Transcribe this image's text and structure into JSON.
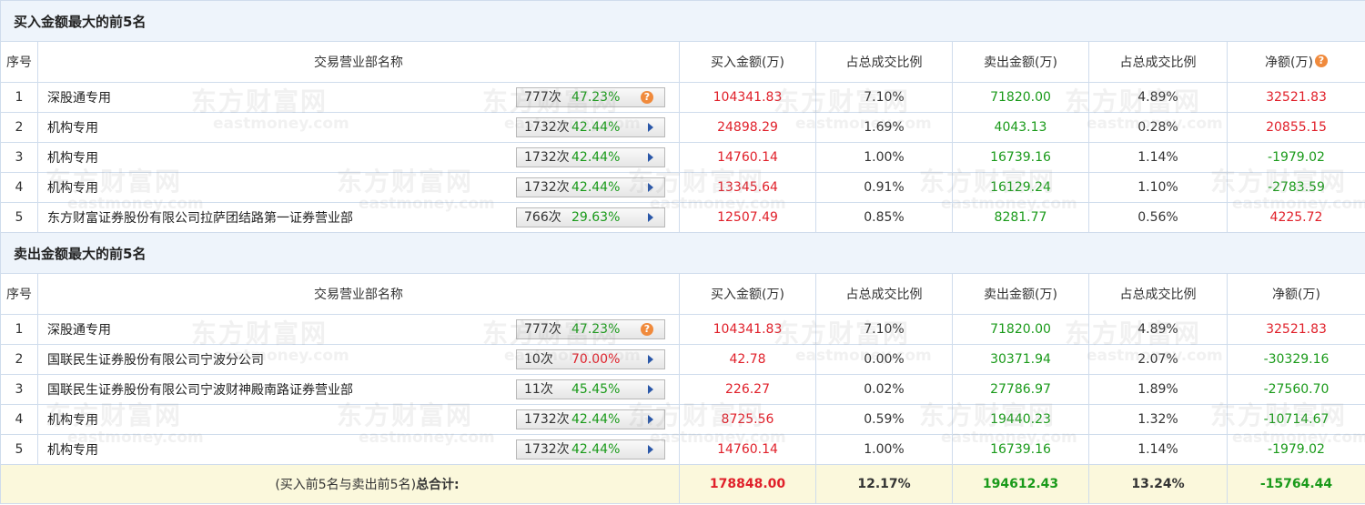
{
  "buy_section": {
    "title": "买入金额最大的前5名",
    "headers": [
      "序号",
      "交易营业部名称",
      "买入金额(万)",
      "占总成交比例",
      "卖出金额(万)",
      "占总成交比例",
      "净额(万)"
    ],
    "net_help_icon": "?",
    "rows": [
      {
        "idx": "1",
        "name": "深股通专用",
        "times": "777次",
        "pct": "47.23%",
        "buy": "104341.83",
        "buy_ratio": "7.10%",
        "sell": "71820.00",
        "sell_ratio": "4.89%",
        "net": "32521.83"
      },
      {
        "idx": "2",
        "name": "机构专用",
        "times": "1732次",
        "pct": "42.44%",
        "buy": "24898.29",
        "buy_ratio": "1.69%",
        "sell": "4043.13",
        "sell_ratio": "0.28%",
        "net": "20855.15"
      },
      {
        "idx": "3",
        "name": "机构专用",
        "times": "1732次",
        "pct": "42.44%",
        "buy": "14760.14",
        "buy_ratio": "1.00%",
        "sell": "16739.16",
        "sell_ratio": "1.14%",
        "net": "-1979.02"
      },
      {
        "idx": "4",
        "name": "机构专用",
        "times": "1732次",
        "pct": "42.44%",
        "buy": "13345.64",
        "buy_ratio": "0.91%",
        "sell": "16129.24",
        "sell_ratio": "1.10%",
        "net": "-2783.59"
      },
      {
        "idx": "5",
        "name": "东方财富证券股份有限公司拉萨团结路第一证券营业部",
        "times": "766次",
        "pct": "29.63%",
        "buy": "12507.49",
        "buy_ratio": "0.85%",
        "sell": "8281.77",
        "sell_ratio": "0.56%",
        "net": "4225.72"
      }
    ]
  },
  "sell_section": {
    "title": "卖出金额最大的前5名",
    "headers": [
      "序号",
      "交易营业部名称",
      "买入金额(万)",
      "占总成交比例",
      "卖出金额(万)",
      "占总成交比例",
      "净额(万)"
    ],
    "rows": [
      {
        "idx": "1",
        "name": "深股通专用",
        "times": "777次",
        "pct": "47.23%",
        "buy": "104341.83",
        "buy_ratio": "7.10%",
        "sell": "71820.00",
        "sell_ratio": "4.89%",
        "net": "32521.83"
      },
      {
        "idx": "2",
        "name": "国联民生证券股份有限公司宁波分公司",
        "times": "10次",
        "pct": "70.00%",
        "buy": "42.78",
        "buy_ratio": "0.00%",
        "sell": "30371.94",
        "sell_ratio": "2.07%",
        "net": "-30329.16"
      },
      {
        "idx": "3",
        "name": "国联民生证券股份有限公司宁波财神殿南路证券营业部",
        "times": "11次",
        "pct": "45.45%",
        "buy": "226.27",
        "buy_ratio": "0.02%",
        "sell": "27786.97",
        "sell_ratio": "1.89%",
        "net": "-27560.70"
      },
      {
        "idx": "4",
        "name": "机构专用",
        "times": "1732次",
        "pct": "42.44%",
        "buy": "8725.56",
        "buy_ratio": "0.59%",
        "sell": "19440.23",
        "sell_ratio": "1.32%",
        "net": "-10714.67"
      },
      {
        "idx": "5",
        "name": "机构专用",
        "times": "1732次",
        "pct": "42.44%",
        "buy": "14760.14",
        "buy_ratio": "1.00%",
        "sell": "16739.16",
        "sell_ratio": "1.14%",
        "net": "-1979.02"
      }
    ]
  },
  "total": {
    "label_prefix": "(买入前5名与卖出前5名)",
    "label_bold": "总合计:",
    "buy": "178848.00",
    "buy_ratio": "12.17%",
    "sell": "194612.43",
    "sell_ratio": "13.24%",
    "net": "-15764.44"
  },
  "watermark": {
    "brand": "东方财富网",
    "domain": "eastmoney.com"
  },
  "colors": {
    "positive": "#e0202a",
    "negative": "#1a9a1a",
    "header_bg": "#eef4fb",
    "border": "#cfdcec",
    "total_bg": "#fbf8dc"
  }
}
